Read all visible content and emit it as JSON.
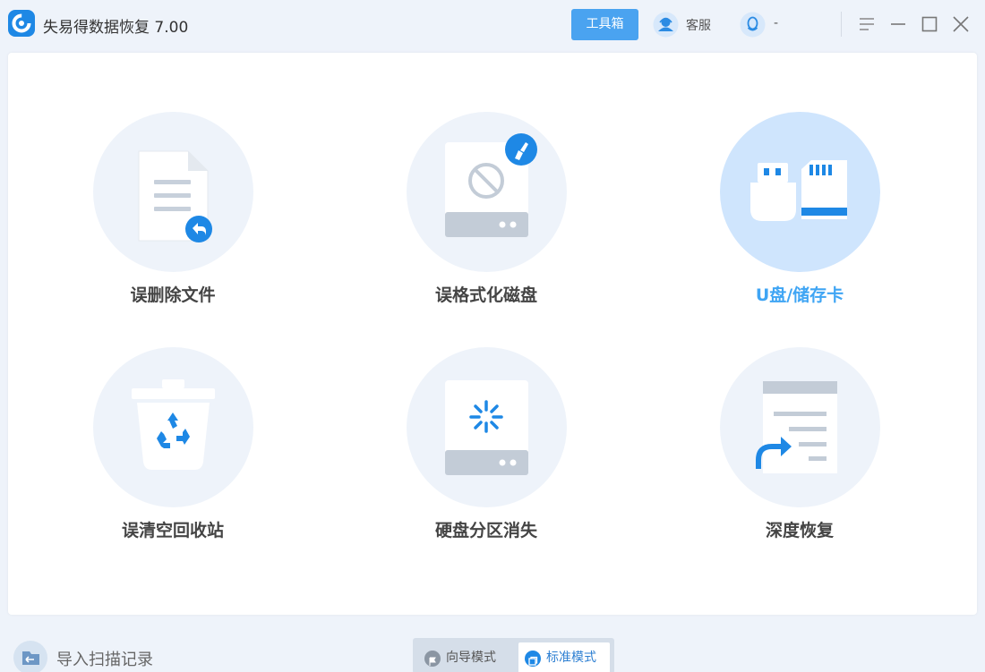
{
  "app": {
    "title": "失易得数据恢复 7.00"
  },
  "header": {
    "toolbox_label": "工具箱",
    "service_label": "客服",
    "qq_label": "-"
  },
  "tiles": [
    {
      "label": "误删除文件",
      "icon": "deleted-file-icon"
    },
    {
      "label": "误格式化磁盘",
      "icon": "formatted-disk-icon"
    },
    {
      "label": "U盘/储存卡",
      "icon": "usb-sd-card-icon",
      "selected": true
    },
    {
      "label": "误清空回收站",
      "icon": "recycle-bin-icon"
    },
    {
      "label": "硬盘分区消失",
      "icon": "lost-partition-icon"
    },
    {
      "label": "深度恢复",
      "icon": "deep-recovery-icon"
    }
  ],
  "footer": {
    "import_label": "导入扫描记录",
    "mode_guide_label": "向导模式",
    "mode_standard_label": "标准模式",
    "active_mode": "标准模式"
  },
  "colors": {
    "accent": "#3fa5f4",
    "button": "#4aa3f0",
    "icon_blue": "#1e88e5",
    "circle_bg": "#eef3fa",
    "circle_active_bg": "#cfe5fd"
  }
}
